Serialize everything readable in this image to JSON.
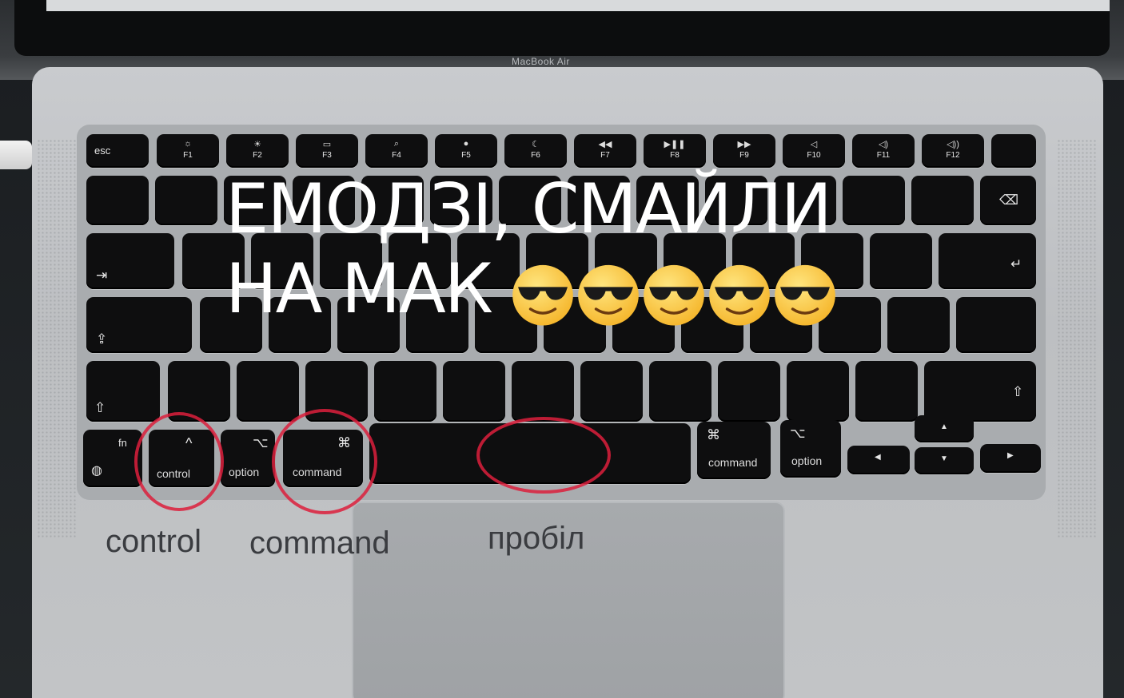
{
  "laptop": {
    "brand": "MacBook Air"
  },
  "overlay": {
    "line1": "ЕМОДЗІ, СМАЙЛИ",
    "line2": "НА МАК",
    "emoji_icon": "smiling-face-with-sunglasses-icon",
    "emoji_count": 5
  },
  "keys": {
    "esc": "esc",
    "f1": "F1",
    "f2": "F2",
    "f3": "F3",
    "f4": "F4",
    "f5": "F5",
    "f6": "F6",
    "f7": "F7",
    "f8": "F8",
    "f9": "F9",
    "f10": "F10",
    "f11": "F11",
    "f12": "F12",
    "fn": "fn",
    "control": "control",
    "control_sym": "^",
    "option": "option",
    "option_sym": "⌥",
    "command": "command",
    "command_sym": "⌘"
  },
  "labels": {
    "control": "control",
    "command": "command",
    "space": "пробіл"
  },
  "colors": {
    "annotation": "#dc1e3c",
    "key": "#0e0e0f",
    "body": "#c4c6c9"
  }
}
